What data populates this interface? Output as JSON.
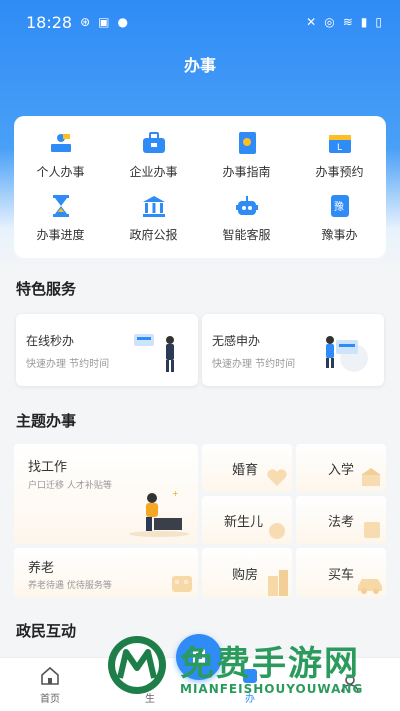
{
  "status_bar": {
    "time": "18:28"
  },
  "header": {
    "title": "办事"
  },
  "quick_actions": [
    {
      "label": "个人办事",
      "icon": "person-desk-icon"
    },
    {
      "label": "企业办事",
      "icon": "briefcase-icon"
    },
    {
      "label": "办事指南",
      "icon": "guide-book-icon"
    },
    {
      "label": "办事预约",
      "icon": "calendar-icon"
    },
    {
      "label": "办事进度",
      "icon": "hourglass-icon"
    },
    {
      "label": "政府公报",
      "icon": "government-building-icon"
    },
    {
      "label": "智能客服",
      "icon": "robot-icon"
    },
    {
      "label": "豫事办",
      "icon": "yu-app-icon"
    }
  ],
  "featured": {
    "title": "特色服务",
    "cards": [
      {
        "title": "在线秒办",
        "subtitle": "快速办理 节约时间"
      },
      {
        "title": "无感申办",
        "subtitle": "快速办理 节约时间"
      }
    ]
  },
  "themes": {
    "title": "主题办事",
    "work": {
      "title": "找工作",
      "subtitle": "户口迁移 人才补贴等"
    },
    "elderly": {
      "title": "养老",
      "subtitle": "养老待遇 优待服务等"
    },
    "items": [
      "婚育",
      "入学",
      "新生儿",
      "法考",
      "购房",
      "买车"
    ]
  },
  "interaction": {
    "title": "政民互动"
  },
  "bottom_nav": [
    {
      "label": "首页",
      "icon": "home-icon"
    },
    {
      "label": "生",
      "icon": "service-icon"
    },
    {
      "label": "办",
      "icon": "task-icon"
    },
    {
      "label": "",
      "icon": "profile-icon"
    }
  ],
  "watermark": {
    "text": "免费手游网",
    "sub": "MIANFEISHOUYOUWANG"
  },
  "colors": {
    "primary": "#2f8cf6",
    "watermark": "#2a9b5c"
  }
}
